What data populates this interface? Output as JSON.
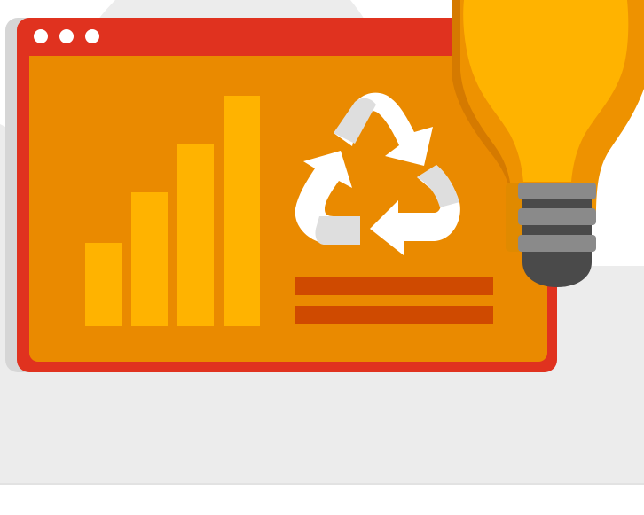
{
  "illustration": {
    "colors": {
      "background_blob": "#ececec",
      "window_shadow": "#d6d6d6",
      "window_frame": "#e0321f",
      "window_content": "#ea8a00",
      "bars": "#ffb300",
      "text_lines": "#cf4a00",
      "recycle_light": "#ffffff",
      "recycle_shade": "#dedede",
      "bulb_outer": "#ee9200",
      "bulb_inner": "#ffb300",
      "bulb_shadow": "#d57a00",
      "bulb_screw_light": "#8a8a8a",
      "bulb_screw_dark": "#4a4a4a",
      "titlebar_dots": "#ffffff"
    },
    "icons": [
      "window-dot-icon",
      "recycle-icon",
      "lightbulb-icon",
      "bar-chart-icon"
    ],
    "bar_chart": {
      "relative_heights": [
        0.36,
        0.58,
        0.79,
        1.0
      ]
    }
  }
}
